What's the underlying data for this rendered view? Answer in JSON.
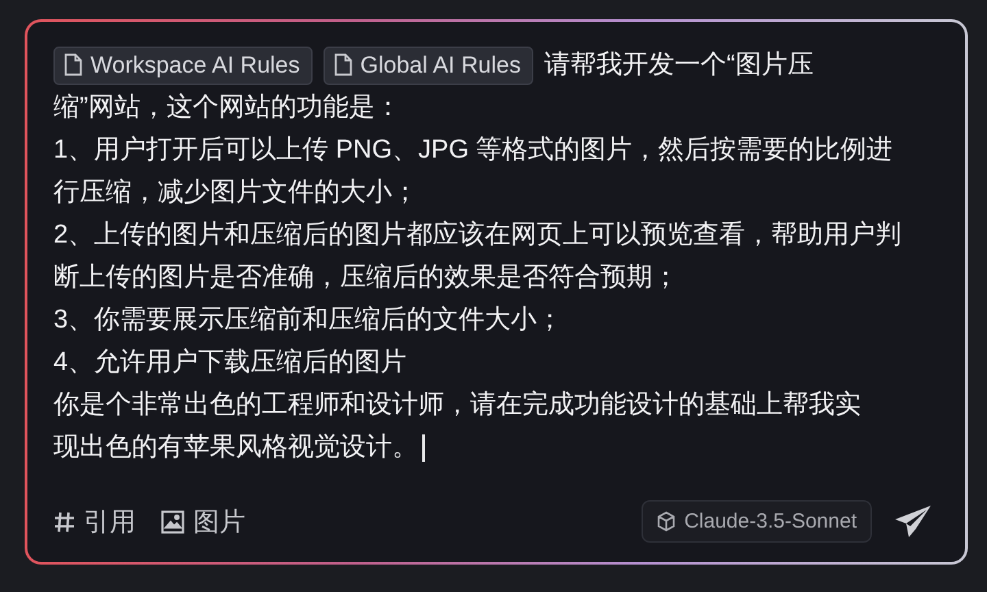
{
  "context_chips": [
    {
      "label": "Workspace AI Rules"
    },
    {
      "label": "Global AI Rules"
    }
  ],
  "prompt": {
    "intro_lines": [
      "请帮我开发一个“图片压",
      "缩”网站，这个网站的功能是："
    ],
    "paragraphs": [
      "1、用户打开后可以上传 PNG、JPG 等格式的图片，然后按需要的比例进行压缩，减少图片文件的大小；",
      "2、上传的图片和压缩后的图片都应该在网页上可以预览查看，帮助用户判断上传的图片是否准确，压缩后的效果是否符合预期；",
      "3、你需要展示压缩前和压缩后的文件大小；",
      "4、允许用户下载压缩后的图片"
    ],
    "closing_lines": [
      "你是个非常出色的工程师和设计师，请在完成功能设计的基础上帮我实",
      "现出色的有苹果风格视觉设计。"
    ]
  },
  "toolbar": {
    "actions": [
      {
        "kind": "hash",
        "label": "引用"
      },
      {
        "kind": "image",
        "label": "图片"
      }
    ],
    "model": "Claude-3.5-Sonnet"
  }
}
